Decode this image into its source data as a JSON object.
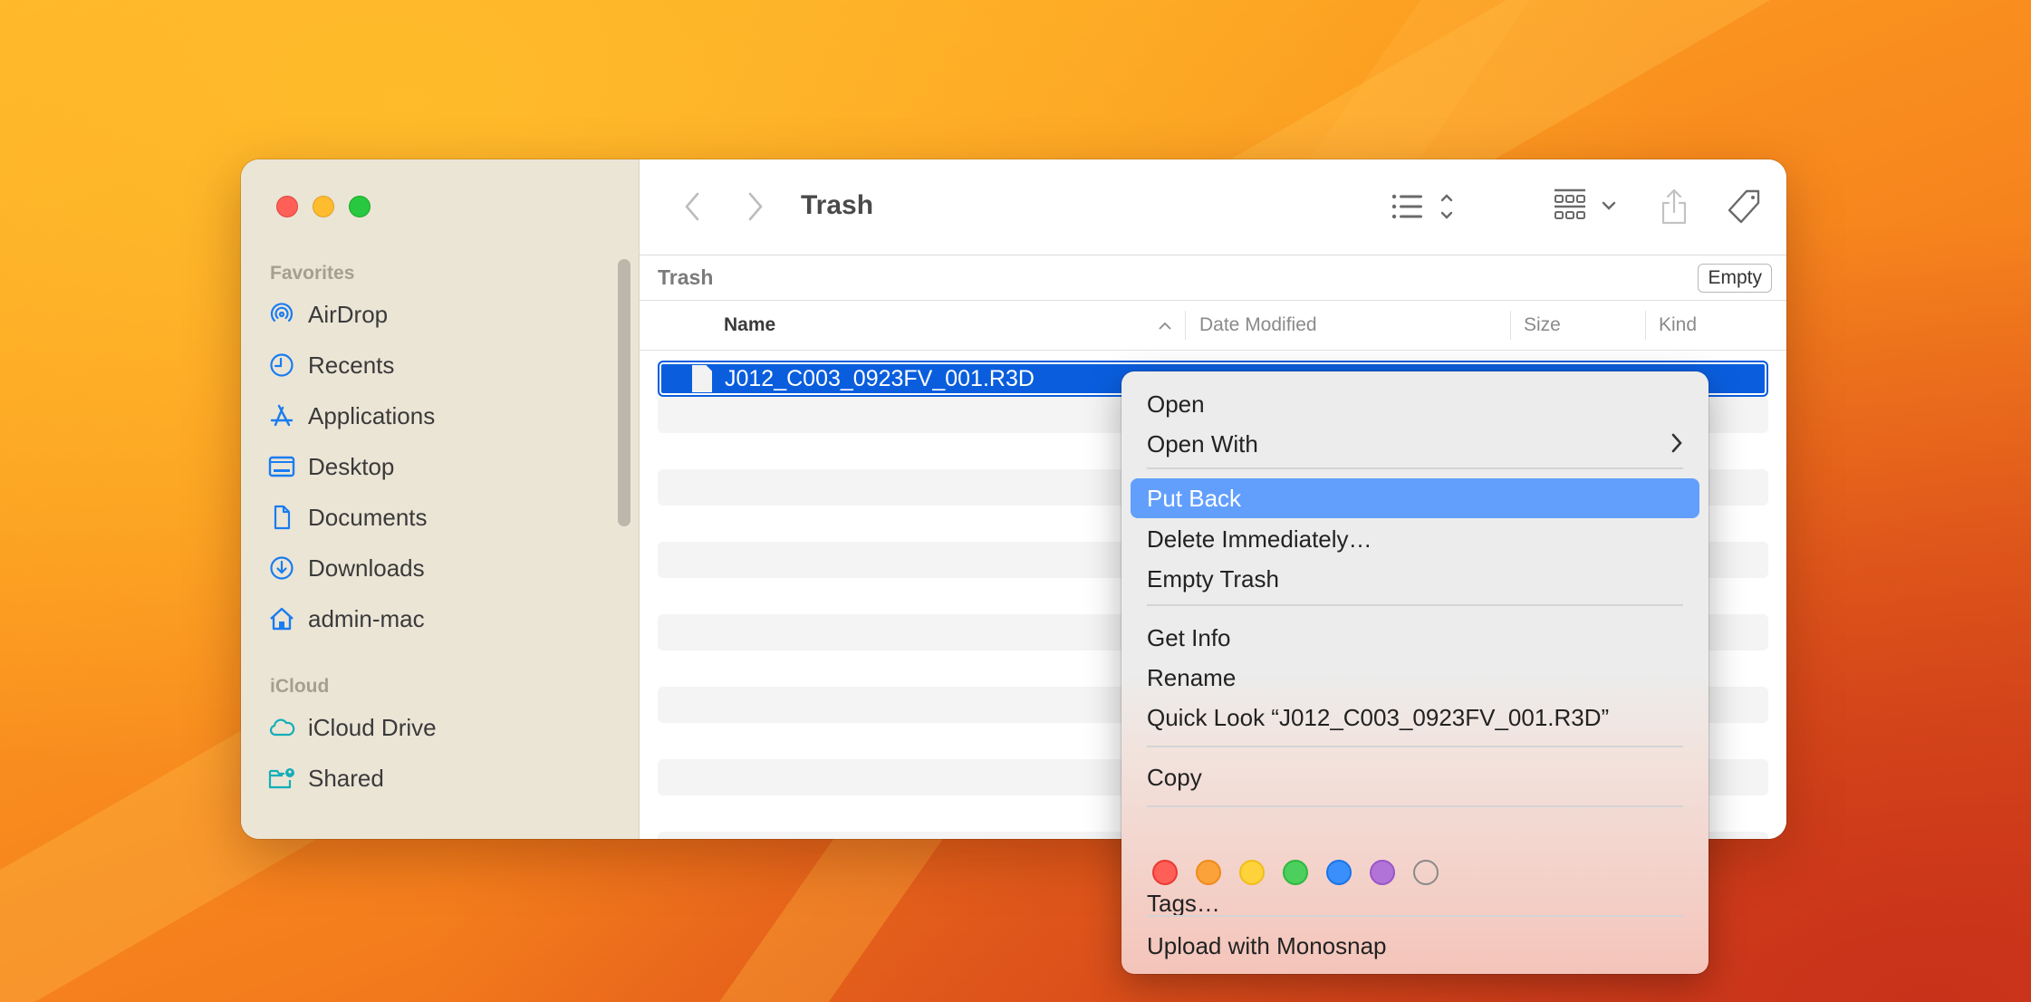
{
  "window": {
    "title": "Trash",
    "traffic_lights": [
      "close",
      "minimize",
      "zoom"
    ]
  },
  "sidebar": {
    "sections": [
      {
        "label": "Favorites",
        "items": [
          {
            "label": "AirDrop",
            "icon": "airdrop-icon"
          },
          {
            "label": "Recents",
            "icon": "clock-icon"
          },
          {
            "label": "Applications",
            "icon": "applications-icon"
          },
          {
            "label": "Desktop",
            "icon": "desktop-icon"
          },
          {
            "label": "Documents",
            "icon": "document-icon"
          },
          {
            "label": "Downloads",
            "icon": "download-icon"
          },
          {
            "label": "admin-mac",
            "icon": "home-icon"
          }
        ]
      },
      {
        "label": "iCloud",
        "items": [
          {
            "label": "iCloud Drive",
            "icon": "cloud-icon"
          },
          {
            "label": "Shared",
            "icon": "shared-folder-icon"
          }
        ]
      }
    ]
  },
  "toolbar": {
    "back_icon": "chevron-left-icon",
    "forward_icon": "chevron-right-icon",
    "title": "Trash",
    "view_icon": "list-view-icon",
    "group_icon": "group-grid-icon",
    "share_icon": "share-icon",
    "tag_icon": "tag-icon",
    "more_icon": "ellipsis-circle-icon",
    "search_icon": "search-icon"
  },
  "pathbar": {
    "label": "Trash",
    "empty_button": "Empty"
  },
  "columns": [
    {
      "label": "Name",
      "sorted": "ascending"
    },
    {
      "label": "Date Modified"
    },
    {
      "label": "Size"
    },
    {
      "label": "Kind"
    }
  ],
  "files": [
    {
      "name": "J012_C003_0923FV_001.R3D",
      "selected": true
    }
  ],
  "context_menu": {
    "items": [
      {
        "label": "Open"
      },
      {
        "label": "Open With",
        "submenu": true
      },
      {
        "label": "Put Back",
        "highlighted": true
      },
      {
        "label": "Delete Immediately…"
      },
      {
        "label": "Empty Trash"
      },
      {
        "label": "Get Info"
      },
      {
        "label": "Rename"
      },
      {
        "label": "Quick Look “J012_C003_0923FV_001.R3D”"
      },
      {
        "label": "Copy"
      },
      {
        "label": "Tags…"
      },
      {
        "label": "Upload with Monosnap"
      }
    ],
    "tag_colors": [
      {
        "name": "red",
        "fill": "#ff5f57",
        "stroke": "#e83a33"
      },
      {
        "name": "orange",
        "fill": "#fba23a",
        "stroke": "#ef8a1a"
      },
      {
        "name": "yellow",
        "fill": "#fdd23a",
        "stroke": "#f0bd1a"
      },
      {
        "name": "green",
        "fill": "#4ccf5c",
        "stroke": "#2eb83f"
      },
      {
        "name": "blue",
        "fill": "#3a8ffc",
        "stroke": "#1a74ea"
      },
      {
        "name": "purple",
        "fill": "#b273d9",
        "stroke": "#9b55c9"
      },
      {
        "name": "gray",
        "fill": "transparent",
        "stroke": "#8a8a8a"
      }
    ]
  },
  "colors": {
    "accent": "#0a5ede",
    "menu_highlight": "#629ffc",
    "sidebar_icon": "#1a7cf0",
    "icloud_icon": "#13aeb8"
  }
}
